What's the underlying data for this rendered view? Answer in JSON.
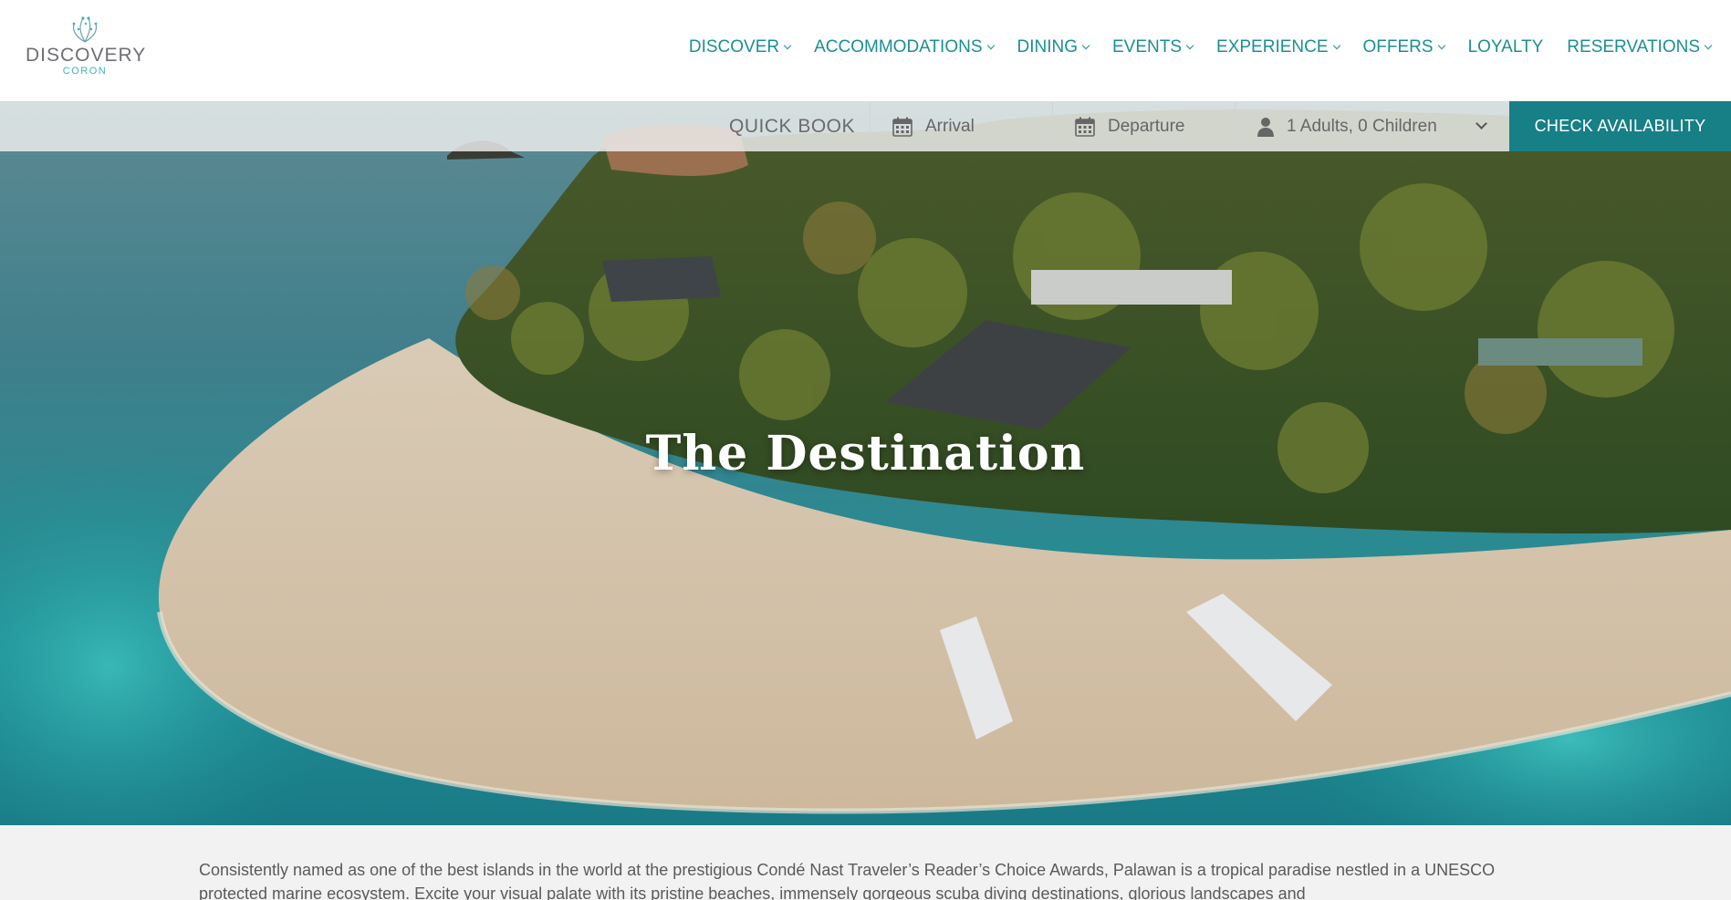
{
  "brand": {
    "name": "DISCOVERY",
    "location": "CORON"
  },
  "nav": [
    {
      "label": "DISCOVER",
      "has_dropdown": true
    },
    {
      "label": "ACCOMMODATIONS",
      "has_dropdown": true
    },
    {
      "label": "DINING",
      "has_dropdown": true
    },
    {
      "label": "EVENTS",
      "has_dropdown": true
    },
    {
      "label": "EXPERIENCE",
      "has_dropdown": true
    },
    {
      "label": "OFFERS",
      "has_dropdown": true
    },
    {
      "label": "LOYALTY",
      "has_dropdown": false
    },
    {
      "label": "RESERVATIONS",
      "has_dropdown": true
    }
  ],
  "quick_book": {
    "label": "QUICK BOOK",
    "arrival_placeholder": "Arrival",
    "departure_placeholder": "Departure",
    "guests_value": "1 Adults, 0 Children",
    "button_label": "CHECK AVAILABILITY"
  },
  "hero": {
    "title": "The Destination"
  },
  "intro": {
    "text": "Consistently named as one of the best islands in the world at the prestigious Condé Nast Traveler’s Reader’s Choice Awards, Palawan is a tropical paradise nestled in a UNESCO protected marine ecosystem. Excite your visual palate with its pristine beaches, immensely gorgeous scuba diving destinations, glorious landscapes and"
  },
  "colors": {
    "accent": "#177f86",
    "nav_text": "#1a8f94",
    "logo_sub": "#3fb3b1",
    "bar_bg": "#f0f0f0"
  },
  "icons": [
    "calendar-icon",
    "person-icon",
    "chevron-down-icon",
    "logo-leaf-icon"
  ]
}
